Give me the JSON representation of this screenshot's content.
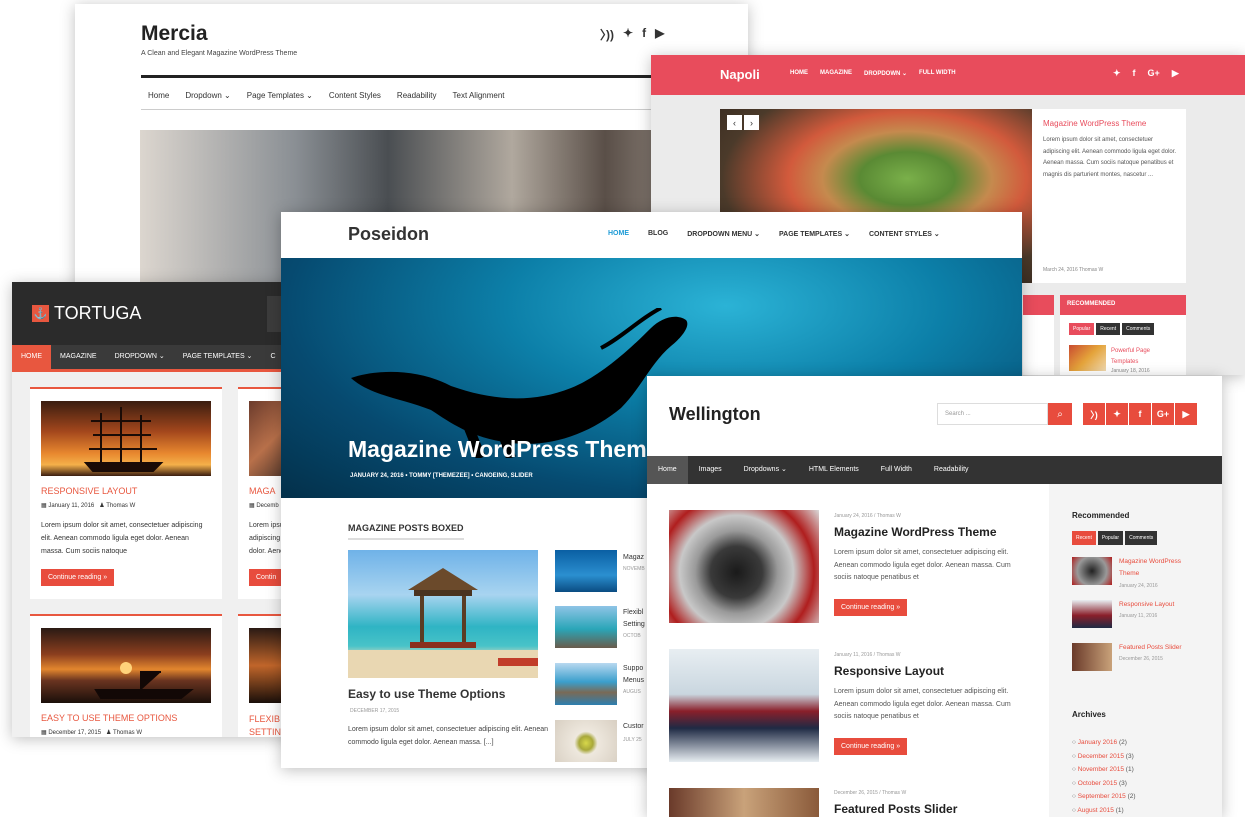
{
  "mercia": {
    "title": "Mercia",
    "tagline": "A Clean and Elegant Magazine WordPress Theme",
    "social": [
      "rss-icon",
      "twitter-icon",
      "facebook-icon",
      "youtube-icon"
    ],
    "nav": [
      "Home",
      "Dropdown ⌄",
      "Page Templates ⌄",
      "Content Styles",
      "Readability",
      "Text Alignment"
    ]
  },
  "napoli": {
    "brand": "Napoli",
    "nav": [
      "HOME",
      "MAGAZINE",
      "DROPDOWN ⌄",
      "FULL WIDTH"
    ],
    "post_title": "Magazine WordPress Theme",
    "post_text": "Lorem ipsum dolor sit amet, consectetuer adipiscing elit. Aenean commodo ligula eget dolor. Aenean massa. Cum sociis natoque penatibus et magnis dis parturient montes, nascetur ...",
    "post_meta": "March 24, 2016     Thomas W",
    "recommended": "RECOMMENDED",
    "tabs": [
      "Popular",
      "Recent",
      "Comments"
    ],
    "rec_title": "Powerful Page Templates",
    "rec_date": "January 18, 2016"
  },
  "tortuga": {
    "logo": "TORTUGA",
    "nav": [
      "HOME",
      "MAGAZINE",
      "DROPDOWN ⌄",
      "PAGE TEMPLATES ⌄",
      "C"
    ],
    "posts": [
      {
        "title": "RESPONSIVE LAYOUT",
        "date": "January 11, 2016",
        "author": "Thomas W",
        "text": "Lorem ipsum dolor sit amet, consectetuer adipiscing elit. Aenean commodo ligula eget dolor. Aenean massa. Cum sociis natoque",
        "button": "Continue reading »"
      },
      {
        "title": "MAGA",
        "date": "Decemb",
        "text": "Lorem ipsu adipiscing e dolor. Aene",
        "button": "Contin"
      },
      {
        "title": "EASY TO USE THEME OPTIONS",
        "date": "December 17, 2015",
        "author": "Thomas W"
      },
      {
        "title": "FLEXIB SETTIN"
      }
    ]
  },
  "poseidon": {
    "brand": "Poseidon",
    "nav": [
      "HOME",
      "BLOG",
      "DROPDOWN MENU ⌄",
      "PAGE TEMPLATES ⌄",
      "CONTENT STYLES ⌄"
    ],
    "hero_title": "Magazine WordPress Theme",
    "hero_meta": "JANUARY 24, 2016  •  TOMMY [THEMEZEE]  •  CANOEING, SLIDER",
    "section": "MAGAZINE POSTS BOXED",
    "big_title": "Easy to use Theme Options",
    "big_date": "DECEMBER 17, 2015",
    "big_text": "Lorem ipsum dolor sit amet, consectetuer adipiscing elit. Aenean commodo ligula eget dolor. Aenean massa. [...]",
    "side_posts": [
      {
        "title": "Magaz",
        "meta": "NOVEMB"
      },
      {
        "title": "Flexibl Setting",
        "meta": "OCTOB"
      },
      {
        "title": "Suppo Menus",
        "meta": "AUGUS"
      },
      {
        "title": "Custor",
        "meta": "JULY 25"
      }
    ]
  },
  "wellington": {
    "brand": "Wellington",
    "search_placeholder": "Search ...",
    "social": [
      "rss-icon",
      "twitter-icon",
      "facebook-icon",
      "googleplus-icon",
      "youtube-icon"
    ],
    "nav": [
      "Home",
      "Images",
      "Dropdowns ⌄",
      "HTML Elements",
      "Full Width",
      "Readability"
    ],
    "posts": [
      {
        "meta": "January 24, 2016  /  Thomas W",
        "title": "Magazine WordPress Theme",
        "text": "Lorem ipsum dolor sit amet, consectetuer adipiscing elit. Aenean commodo ligula eget dolor. Aenean massa. Cum sociis natoque penatibus et",
        "button": "Continue reading »"
      },
      {
        "meta": "January 11, 2016  /  Thomas W",
        "title": "Responsive Layout",
        "text": "Lorem ipsum dolor sit amet, consectetuer adipiscing elit. Aenean commodo ligula eget dolor. Aenean massa. Cum sociis natoque penatibus et",
        "button": "Continue reading »"
      },
      {
        "meta": "December 26, 2015  /  Thomas W",
        "title": "Featured Posts Slider"
      }
    ],
    "recommended": "Recommended",
    "tabs": [
      "Recent",
      "Popular",
      "Comments"
    ],
    "side_posts": [
      {
        "title": "Magazine WordPress Theme",
        "date": "January 24, 2016"
      },
      {
        "title": "Responsive Layout",
        "date": "January 11, 2016"
      },
      {
        "title": "Featured Posts Slider",
        "date": "December 26, 2015"
      }
    ],
    "archives_title": "Archives",
    "archives": [
      {
        "label": "January 2016",
        "count": "(2)"
      },
      {
        "label": "December 2015",
        "count": "(3)"
      },
      {
        "label": "November 2015",
        "count": "(1)"
      },
      {
        "label": "October 2015",
        "count": "(3)"
      },
      {
        "label": "September 2015",
        "count": "(2)"
      },
      {
        "label": "August 2015",
        "count": "(1)"
      }
    ]
  }
}
